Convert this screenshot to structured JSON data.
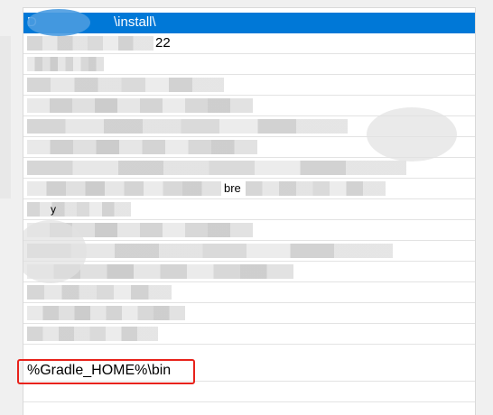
{
  "list": {
    "selected_text": "D",
    "selected_suffix": "\\install\\",
    "row_1_suffix": "22",
    "row_8_fragment": "bre",
    "row_10_fragment": "y",
    "gradle_entry": "%Gradle_HOME%\\bin"
  },
  "colors": {
    "selection": "#0078d7",
    "highlight_box": "#e8221b"
  }
}
